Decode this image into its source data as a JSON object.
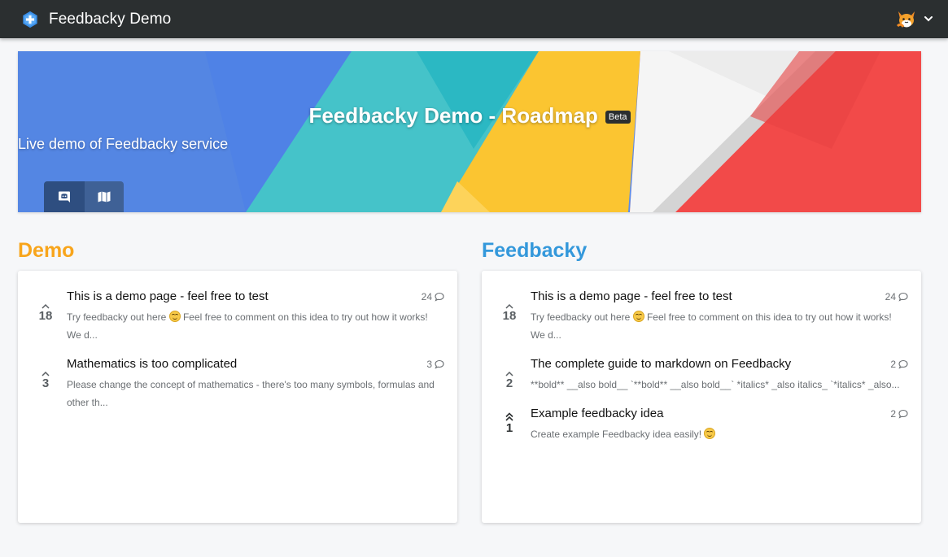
{
  "navbar": {
    "brand_title": "Feedbacky Demo",
    "logo_icon": "feedbacky-logo-icon",
    "avatar_icon": "user-avatar-icon",
    "menu_icon": "chevron-down-icon"
  },
  "banner": {
    "title": "Feedbacky Demo - Roadmap",
    "badge": "Beta",
    "subtitle": "Live demo of Feedbacky service",
    "buttons": [
      {
        "icon": "discord-icon"
      },
      {
        "icon": "map-icon"
      }
    ]
  },
  "columns": [
    {
      "title": "Demo",
      "color": "#f8a51c",
      "items": [
        {
          "votes": "18",
          "title": "This is a demo page - feel free to test",
          "desc_pre": "Try feedbacky out here ",
          "desc_post": " Feel free to comment on this idea to try out how it works! We d...",
          "comments": "24"
        },
        {
          "votes": "3",
          "title": "Mathematics is too complicated",
          "desc_pre": "Please change the concept of mathematics - there's too many symbols, formulas and other th...",
          "desc_post": "",
          "comments": "3"
        }
      ]
    },
    {
      "title": "Feedbacky",
      "color": "#3498db",
      "items": [
        {
          "votes": "18",
          "title": "This is a demo page - feel free to test",
          "desc_pre": "Try feedbacky out here ",
          "desc_post": " Feel free to comment on this idea to try out how it works! We d...",
          "comments": "24"
        },
        {
          "votes": "2",
          "title": "The complete guide to markdown on Feedbacky",
          "desc_pre": "**bold** __also bold__ `**bold** __also bold__` *italics* _also italics_ `*italics* _also...",
          "desc_post": "",
          "comments": "2"
        },
        {
          "votes": "1",
          "title": "Example feedbacky idea",
          "desc_pre": "Create example Feedbacky idea easily! ",
          "desc_post": "",
          "comments": "2"
        }
      ]
    }
  ]
}
